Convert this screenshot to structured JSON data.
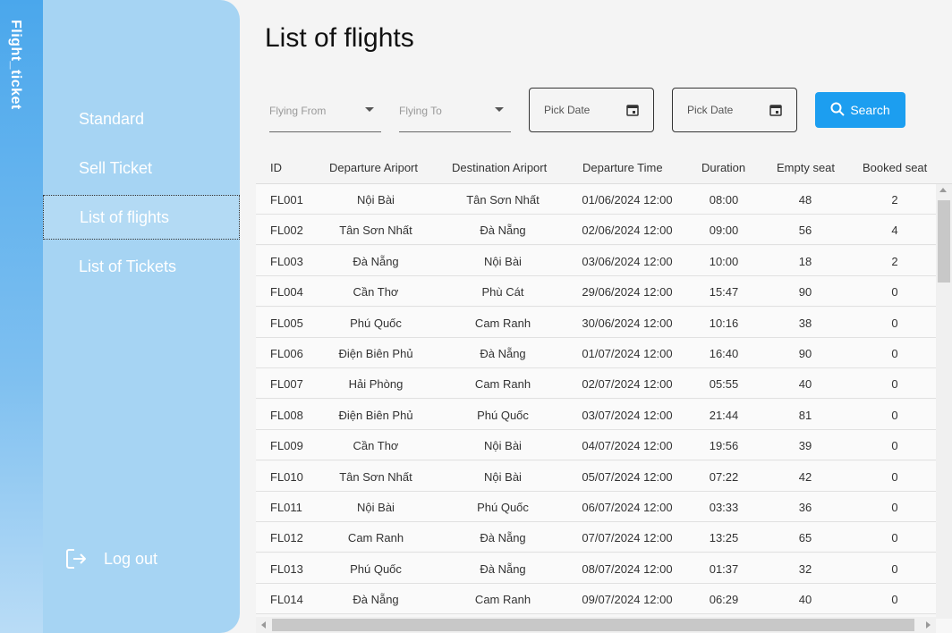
{
  "app": {
    "vertical_title": "Flight_ticket"
  },
  "sidebar": {
    "items": [
      {
        "label": "Standard"
      },
      {
        "label": "Sell Ticket"
      },
      {
        "label": "List of flights"
      },
      {
        "label": "List of Tickets"
      }
    ],
    "active_index": 2,
    "logout_label": "Log out"
  },
  "main": {
    "title": "List of flights",
    "filters": {
      "from_placeholder": "Flying From",
      "to_placeholder": "Flying To",
      "date1_placeholder": "Pick Date",
      "date2_placeholder": "Pick Date",
      "search_label": "Search"
    }
  },
  "table": {
    "headers": [
      "ID",
      "Departure Ariport",
      "Destination Ariport",
      "Departure Time",
      "Duration",
      "Empty seat",
      "Booked seat"
    ],
    "rows": [
      [
        "FL001",
        "Nội Bài",
        "Tân Sơn Nhất",
        "01/06/2024 12:00",
        "08:00",
        "48",
        "2"
      ],
      [
        "FL002",
        "Tân Sơn Nhất",
        "Đà Nẵng",
        "02/06/2024 12:00",
        "09:00",
        "56",
        "4"
      ],
      [
        "FL003",
        "Đà Nẵng",
        "Nội Bài",
        "03/06/2024 12:00",
        "10:00",
        "18",
        "2"
      ],
      [
        "FL004",
        "Cần Thơ",
        "Phù Cát",
        "29/06/2024 12:00",
        "15:47",
        "90",
        "0"
      ],
      [
        "FL005",
        "Phú Quốc",
        "Cam Ranh",
        "30/06/2024 12:00",
        "10:16",
        "38",
        "0"
      ],
      [
        "FL006",
        "Điện Biên Phủ",
        "Đà Nẵng",
        "01/07/2024 12:00",
        "16:40",
        "90",
        "0"
      ],
      [
        "FL007",
        "Hải Phòng",
        "Cam Ranh",
        "02/07/2024 12:00",
        "05:55",
        "40",
        "0"
      ],
      [
        "FL008",
        "Điện Biên Phủ",
        "Phú Quốc",
        "03/07/2024 12:00",
        "21:44",
        "81",
        "0"
      ],
      [
        "FL009",
        "Cần Thơ",
        "Nội Bài",
        "04/07/2024 12:00",
        "19:56",
        "39",
        "0"
      ],
      [
        "FL010",
        "Tân Sơn Nhất",
        "Nội Bài",
        "05/07/2024 12:00",
        "07:22",
        "42",
        "0"
      ],
      [
        "FL011",
        "Nội Bài",
        "Phú Quốc",
        "06/07/2024 12:00",
        "03:33",
        "36",
        "0"
      ],
      [
        "FL012",
        "Cam Ranh",
        "Đà Nẵng",
        "07/07/2024 12:00",
        "13:25",
        "65",
        "0"
      ],
      [
        "FL013",
        "Phú Quốc",
        "Đà Nẵng",
        "08/07/2024 12:00",
        "01:37",
        "32",
        "0"
      ],
      [
        "FL014",
        "Đà Nẵng",
        "Cam Ranh",
        "09/07/2024 12:00",
        "06:29",
        "40",
        "0"
      ]
    ]
  },
  "colors": {
    "accent": "#1c9ef0",
    "sidebar": "#a6d4f3",
    "strip": "#4aa7ec"
  },
  "icons": {
    "calendar": "calendar-icon",
    "search": "search-icon",
    "logout": "logout-icon",
    "dropdown": "chevron-down-icon"
  }
}
